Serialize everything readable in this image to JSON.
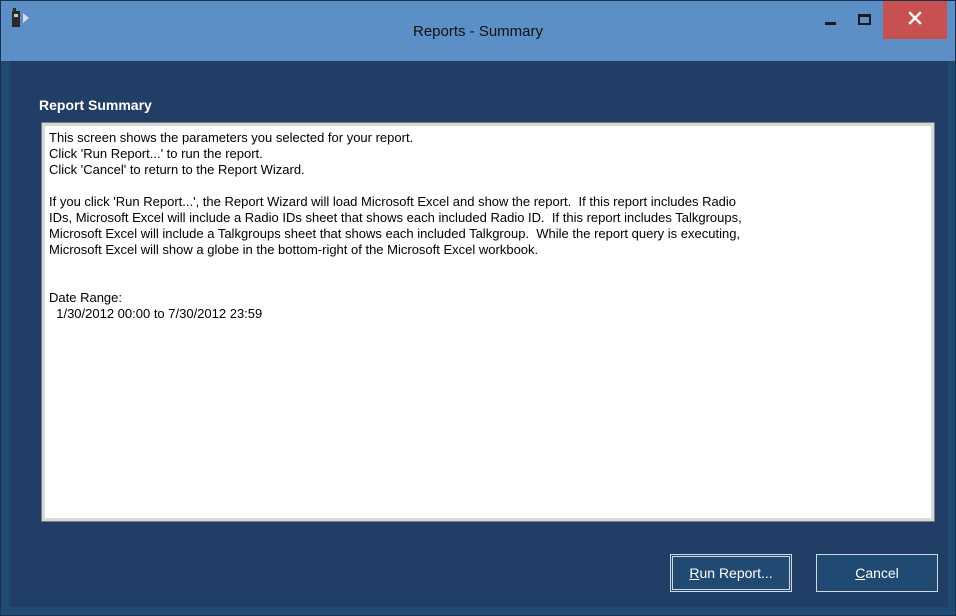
{
  "window": {
    "title": "Reports - Summary"
  },
  "icons": {
    "app": "radio-device-icon",
    "minimize": "minimize-icon",
    "maximize": "maximize-icon",
    "close": "close-icon"
  },
  "summary": {
    "heading": "Report Summary",
    "lines": [
      "This screen shows the parameters you selected for your report.",
      "Click 'Run Report...' to run the report.",
      "Click 'Cancel' to return to the Report Wizard.",
      "",
      "If you click 'Run Report...', the Report Wizard will load Microsoft Excel and show the report.  If this report includes Radio",
      "IDs, Microsoft Excel will include a Radio IDs sheet that shows each included Radio ID.  If this report includes Talkgroups,",
      "Microsoft Excel will include a Talkgroups sheet that shows each included Talkgroup.  While the report query is executing,",
      "Microsoft Excel will show a globe in the bottom-right of the Microsoft Excel workbook.",
      "",
      "",
      "Date Range:",
      "  1/30/2012 00:00 to 7/30/2012 23:59"
    ]
  },
  "buttons": {
    "run_first": "R",
    "run_rest": "un Report...",
    "cancel_first": "C",
    "cancel_rest": "ancel"
  },
  "colors": {
    "titlebar": "#5b8fc6",
    "client": "#213f66",
    "close": "#c75050"
  }
}
